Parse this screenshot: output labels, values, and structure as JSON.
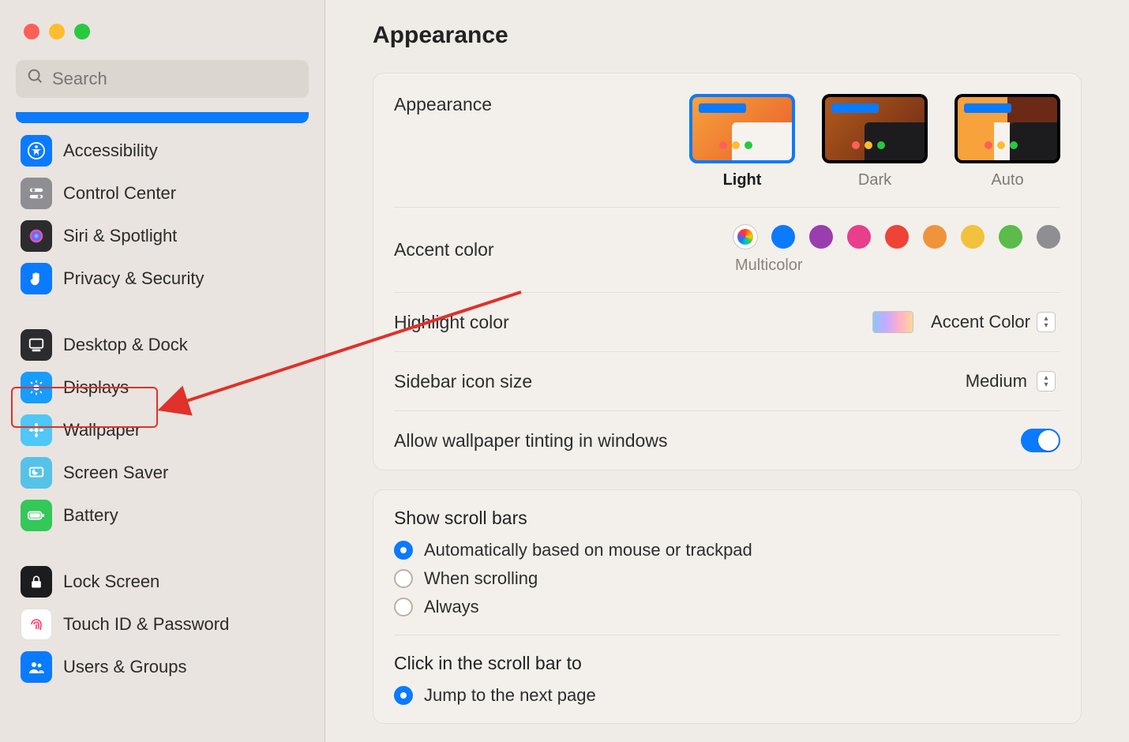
{
  "search": {
    "placeholder": "Search"
  },
  "sidebar": {
    "items": [
      {
        "label": "Accessibility"
      },
      {
        "label": "Control Center"
      },
      {
        "label": "Siri & Spotlight"
      },
      {
        "label": "Privacy & Security"
      },
      {
        "label": "Desktop & Dock"
      },
      {
        "label": "Displays"
      },
      {
        "label": "Wallpaper"
      },
      {
        "label": "Screen Saver"
      },
      {
        "label": "Battery"
      },
      {
        "label": "Lock Screen"
      },
      {
        "label": "Touch ID & Password"
      },
      {
        "label": "Users & Groups"
      }
    ]
  },
  "page": {
    "title": "Appearance"
  },
  "appearance": {
    "section_label": "Appearance",
    "options": {
      "light": "Light",
      "dark": "Dark",
      "auto": "Auto"
    }
  },
  "accent": {
    "label": "Accent color",
    "caption": "Multicolor",
    "colors": [
      "#0a7aff",
      "#9a3ead",
      "#e83e8c",
      "#ef4338",
      "#f0943b",
      "#f2c23c",
      "#5bbb4b",
      "#8e8e93"
    ]
  },
  "highlight": {
    "label": "Highlight color",
    "value": "Accent Color"
  },
  "sidebar_size": {
    "label": "Sidebar icon size",
    "value": "Medium"
  },
  "tinting": {
    "label": "Allow wallpaper tinting in windows",
    "on": true
  },
  "scrollbars": {
    "heading": "Show scroll bars",
    "options": [
      {
        "label": "Automatically based on mouse or trackpad",
        "checked": true
      },
      {
        "label": "When scrolling",
        "checked": false
      },
      {
        "label": "Always",
        "checked": false
      }
    ]
  },
  "click_scrollbar": {
    "heading": "Click in the scroll bar to",
    "options": [
      {
        "label": "Jump to the next page",
        "checked": true
      }
    ]
  },
  "annotation": {
    "target_sidebar_item": "Displays"
  }
}
